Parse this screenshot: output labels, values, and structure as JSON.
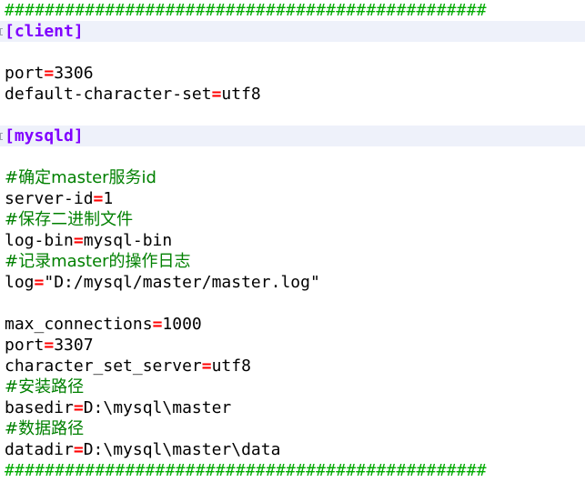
{
  "editor": {
    "lines": [
      {
        "kind": "separator",
        "text": "################################################"
      },
      {
        "kind": "section",
        "text": "[client]"
      },
      {
        "kind": "blank",
        "text": ""
      },
      {
        "kind": "kv",
        "key": "port",
        "eq": "=",
        "value": "3306"
      },
      {
        "kind": "kv",
        "key": "default-character-set",
        "eq": "=",
        "value": "utf8"
      },
      {
        "kind": "blank",
        "text": ""
      },
      {
        "kind": "section",
        "text": "[mysqld]"
      },
      {
        "kind": "blank",
        "text": ""
      },
      {
        "kind": "comment",
        "text": "#确定master服务id"
      },
      {
        "kind": "kv",
        "key": "server-id",
        "eq": "=",
        "value": "1"
      },
      {
        "kind": "comment",
        "text": "#保存二进制文件"
      },
      {
        "kind": "kv",
        "key": "log-bin",
        "eq": "=",
        "value": "mysql-bin"
      },
      {
        "kind": "comment",
        "text": "#记录master的操作日志"
      },
      {
        "kind": "kv",
        "key": "log",
        "eq": "=",
        "value": "\"D:/mysql/master/master.log\""
      },
      {
        "kind": "blank",
        "text": ""
      },
      {
        "kind": "kv",
        "key": "max_connections",
        "eq": "=",
        "value": "1000"
      },
      {
        "kind": "kv",
        "key": "port",
        "eq": "=",
        "value": "3307"
      },
      {
        "kind": "kv",
        "key": "character_set_server",
        "eq": "=",
        "value": "utf8"
      },
      {
        "kind": "comment",
        "text": "#安装路径"
      },
      {
        "kind": "kv",
        "key": "basedir",
        "eq": "=",
        "value": "D:\\mysql\\master"
      },
      {
        "kind": "comment",
        "text": "#数据路径"
      },
      {
        "kind": "kv",
        "key": "datadir",
        "eq": "=",
        "value": "D:\\mysql\\master\\data"
      },
      {
        "kind": "separator",
        "text": "################################################"
      }
    ]
  },
  "colors": {
    "separator": "#00aa00",
    "section": "#8000ff",
    "equals": "#ff0000",
    "comment": "#008000",
    "text": "#000000",
    "section_background": "#eef1fa"
  }
}
